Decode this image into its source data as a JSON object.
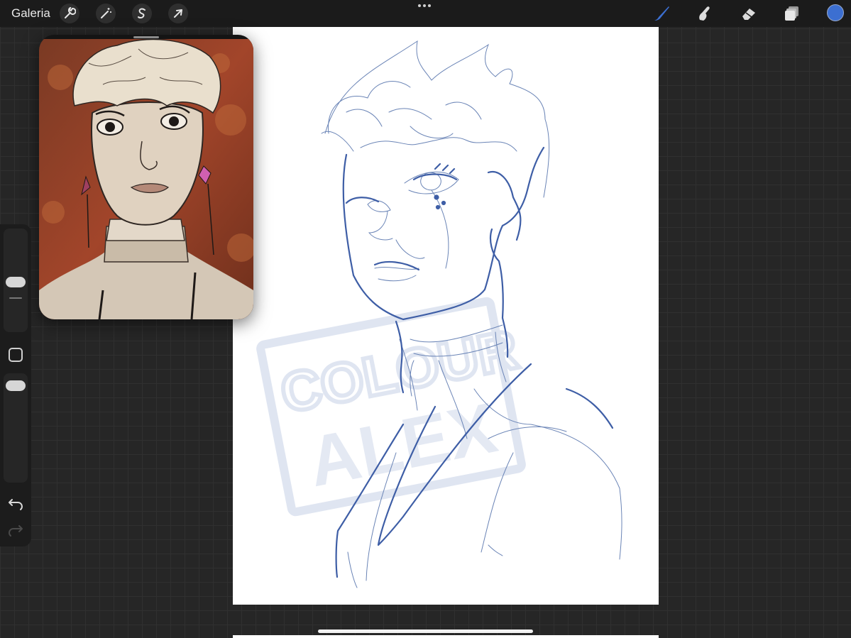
{
  "app": {
    "gallery_label": "Galeria",
    "accent_color": "#3c6fd1"
  },
  "toolbar": {
    "left_tools": [
      {
        "name": "actions",
        "icon": "wrench-icon"
      },
      {
        "name": "adjustments",
        "icon": "magic-wand-icon"
      },
      {
        "name": "selection",
        "icon": "selection-s-icon"
      },
      {
        "name": "transform",
        "icon": "cursor-arrow-icon"
      }
    ],
    "more_icon": "ellipsis-icon",
    "right_tools": [
      {
        "name": "brush",
        "icon": "brush-icon",
        "active": true
      },
      {
        "name": "smudge",
        "icon": "smudge-finger-icon",
        "active": false
      },
      {
        "name": "eraser",
        "icon": "eraser-icon",
        "active": false
      },
      {
        "name": "layers",
        "icon": "layers-icon",
        "active": false
      }
    ],
    "current_color": "#3c6fd1"
  },
  "canvas": {
    "watermark_lines": [
      "COLOUR",
      "ALEX"
    ],
    "stroke_color": "#3e5ea6",
    "watermark_color": "#dfe5f1"
  },
  "reference_window": {
    "icon": "reference-image"
  },
  "sidebar": {
    "brush_size_icon": "size-slider-icon",
    "modify_icon": "square-modifier-icon",
    "opacity_icon": "opacity-slider-icon",
    "undo_icon": "undo-icon",
    "redo_icon": "redo-icon"
  }
}
